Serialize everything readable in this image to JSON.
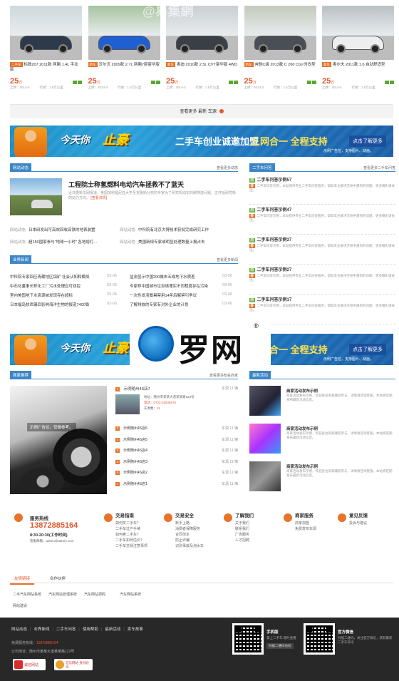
{
  "cars": [
    {
      "tag": "二手车",
      "title": "标致207 2011款 两厢 1.4L 手动版",
      "price": "25",
      "unit": "万",
      "date": "上牌：2014-3",
      "km": "行驶：1.5万公里",
      "color": "#2d3a4a",
      "bg": "#cfd8dc"
    },
    {
      "tag": "新车",
      "title": "沃尔沃 2009款 2.7L 两厢7座豪华版",
      "price": "25",
      "unit": "万",
      "date": "上牌：2014-3",
      "km": "行驶：1.5万公里",
      "color": "#1f5fd1",
      "bg": "#a7c3a0"
    },
    {
      "tag": "新车",
      "title": "奥迪 2010款 2.5L CVT豪华版 4WD",
      "price": "25",
      "unit": "万",
      "date": "上牌：2014-3",
      "km": "行驶：1.5万公里",
      "color": "#3a3f45",
      "bg": "#c9ced2"
    },
    {
      "tag": "新车",
      "title": "奔驰C级 2013款 C 260 CGI 时尚型",
      "price": "25",
      "unit": "万",
      "date": "上牌：2014-3",
      "km": "行驶：1.5万公里",
      "color": "#4a4f55",
      "bg": "#c4c9bd"
    },
    {
      "tag": "新车",
      "title": "奥尔夫 2011款 1.6 自动舒适型",
      "price": "25",
      "unit": "万",
      "date": "上牌：2014-3",
      "km": "行驶：1.5万公里",
      "color": "#eeeeee",
      "bg": "#b9c0c4"
    }
  ],
  "watermark": "@易集網",
  "more_cars": "查看更多 最新 车源",
  "banner": {
    "w1": "今天你",
    "w2": "止豪",
    "w3": "二手车创业诚邀加盟",
    "w4": "三网合一 全程支持",
    "btn": "点击了解更多",
    "note": "示例广告位，支持图片、动画。"
  },
  "news": {
    "tab": "网站动态",
    "more": "查看更多动态",
    "headline": "工程院士称氢燃料电动汽车拯救不了蓝天",
    "summary": "近日据新华网报道，美国加利福尼亚大学圣克鲁斯分校的专家为了研究机动车的碳排放问题，正开始研究新的动力方向。",
    "detail": "[查看详情]",
    "links": [
      {
        "cat": "网站动态",
        "title": "日本研发出可高效回收高铁的地表装置"
      },
      {
        "cat": "网站动态",
        "title": "中科院有北京大博技术获批完成研究工作"
      },
      {
        "cat": "网站动态",
        "title": "超150国家参与“地球一小时” 各地熄灯..."
      },
      {
        "cat": "网站动态",
        "title": "美国新规专家或明显处理数量上报占去"
      }
    ]
  },
  "industry": {
    "tab": "业界新闻",
    "more": "查看更多新闻",
    "items": [
      {
        "title": "中科院专家回应青藏地区铝矿 社会认知和模拟",
        "date": "03-06"
      },
      {
        "title": "监测显示中国200城市五成地下水质差",
        "date": "03-06"
      },
      {
        "title": "中石化董事长称化工厂污水处理应可双控",
        "date": "03-06"
      },
      {
        "title": "专家称中国城市垃圾填埋实不同程度存在污染",
        "date": "03-06"
      },
      {
        "title": "室内美国地下水资源被发现存在超标",
        "date": "03-06"
      },
      {
        "title": "一次性发泡餐具禁用14年后解禁引争议",
        "date": "03-06"
      },
      {
        "title": "日本福岛核泄漏后影响海洋生物的报道7400铢",
        "date": "03-06"
      },
      {
        "title": "了解排放的专家有对外企业的计划",
        "date": "03-06"
      }
    ]
  },
  "qa": {
    "tab": "二手车问答",
    "more": "查看更多二手车问答",
    "items": [
      {
        "q": "二手车问答示例5？",
        "a": "二手车问答示例，本站提供专业二手车问答服务，帮助车主解决交易中遇到的问题，更多精彩请关注。"
      },
      {
        "q": "二手车问答示例4？",
        "a": "二手车问答示例，本站提供专业二手车问答服务，帮助车主解决交易中遇到的问题，更多精彩请关注。"
      },
      {
        "q": "二手车问答示例3？",
        "a": "二手车问答示例，本站提供专业二手车问答服务，帮助车主解决交易中遇到的问题，更多精彩请关注。"
      },
      {
        "q": "二手车问答示例2？",
        "a": "二手车问答示例，本站提供专业二手车问答服务，帮助车主解决交易中遇到的问题，更多精彩请关注。"
      },
      {
        "q": "二手车问答示例1？",
        "a": "二手车问答示例，本站提供专业二手车问答服务，帮助车主解决交易中遇到的问题，更多精彩请关注。"
      }
    ]
  },
  "logo": {
    "text": "罗网",
    "reg": "®"
  },
  "shops": {
    "tab": "商家推荐",
    "more": "查看更多知名商家",
    "ad": "示例广告位，仅做参考。",
    "featured": {
      "name": "示例随州4S店7",
      "addr": "地址：随州市某某大道某某路123号",
      "tel": "电话：0722-32545676",
      "count_label": "车源数：",
      "count": "11"
    },
    "items": [
      {
        "n": "1",
        "name": "示例随州4S店7",
        "right": "车源 11 辆"
      },
      {
        "n": "2",
        "name": "示例随州4S店6",
        "right": "车源 11 辆"
      },
      {
        "n": "3",
        "name": "示例随州4S店5",
        "right": "车源 11 辆"
      },
      {
        "n": "4",
        "name": "示例随州4S店4",
        "right": "车源 11 辆"
      },
      {
        "n": "5",
        "name": "示例随州4S店3",
        "right": "车源 11 辆"
      },
      {
        "n": "6",
        "name": "示例随州4S店2",
        "right": "车源 11 辆"
      },
      {
        "n": "7",
        "name": "示例随州4S店1",
        "right": "车源 11 辆"
      }
    ]
  },
  "events": {
    "tab": "最新活动",
    "items": [
      {
        "t": "商家活动发布示例",
        "s": "商家活动发布示例，欢迎各位商家踊跃参与，详情请咨询客服，本站将定期发布最新活动信息。"
      },
      {
        "t": "商家活动发布示例",
        "s": "商家活动发布示例，欢迎各位商家踊跃参与，详情请咨询客服，本站将定期发布最新活动信息。"
      },
      {
        "t": "商家活动发布示例",
        "s": "商家活动发布示例，欢迎各位商家踊跃参与，详情请咨询客服，本站将定期发布最新活动信息。"
      }
    ]
  },
  "service": {
    "title": "服务热线",
    "phone": "13872885164",
    "hours": "8:30-20:30(工作时间)",
    "email": "客服邮箱：admin@admin.com"
  },
  "footcols": [
    {
      "h": "交易指南",
      "items": [
        "如何买二手车？",
        "二手车过户手续",
        "如何卖二手车？",
        "二手车如何估价？",
        "二手车交易注意事项"
      ]
    },
    {
      "h": "交易安全",
      "items": [
        "新手上路",
        "消费者保障服务",
        "合同范本",
        "防止诈骗",
        "识别事故及泡水车"
      ]
    },
    {
      "h": "了解我们",
      "items": [
        "关于我们",
        "联系我们",
        "广告服务",
        "人才招聘"
      ]
    },
    {
      "h": "商家服务",
      "items": [
        "商家加盟",
        "免费发布车源"
      ]
    },
    {
      "h": "意见反馈",
      "items": [
        "投诉与建议"
      ]
    }
  ],
  "friend": {
    "tab1": "友情链接",
    "tab2": "合作伙伴",
    "links": [
      "二手汽车网站系统",
      "汽车网站管理系统",
      "汽车网站源码",
      "汽车网站系统",
      "网站建设"
    ]
  },
  "footer": {
    "links": [
      "网站动态",
      "业界新闻",
      "二手车问答",
      "使用帮助",
      "最新活动",
      "卖车故事"
    ],
    "phone_label": "免费服务热线：",
    "phone": "13872885164",
    "addr": "公司地址：随州市某某大道某某路123号",
    "badge1": "诚信网站",
    "badge2": "可信网站 身份验证",
    "app_title": "手机版",
    "app_sub": "掌上二手车 随时查看",
    "app_btn": "扫描二维码访问",
    "wx_title": "官方微信",
    "wx_sub": "扫描二维码，关注官方微信，获取最新二手车资讯"
  }
}
